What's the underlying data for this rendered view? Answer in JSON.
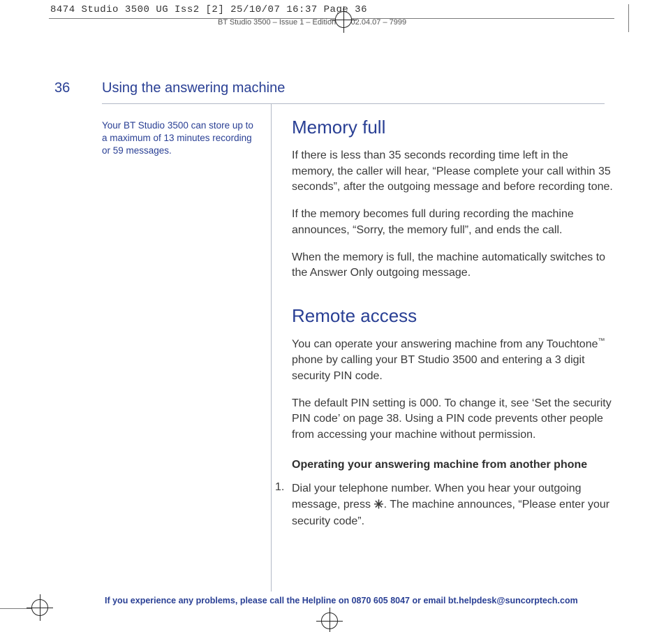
{
  "print": {
    "header": "8474 Studio 3500 UG Iss2 [2]  25/10/07  16:37  Page 36",
    "subheader": "BT Studio 3500 – Issue 1 – Edition 2.1  02.04.07 – 7999"
  },
  "page": {
    "number": "36",
    "section": "Using the answering machine"
  },
  "sidenote": "Your BT Studio 3500 can store up to a maximum of 13 minutes recording or 59 messages.",
  "memory": {
    "heading": "Memory full",
    "p1": "If there is less than 35 seconds recording time left in the memory, the caller will hear, “Please complete your call within 35 seconds”, after the outgoing message and before recording tone.",
    "p2": "If the memory becomes full during recording the machine announces, “Sorry, the memory full”, and ends the call.",
    "p3": "When the memory is full, the machine automatically switches to the Answer Only outgoing message."
  },
  "remote": {
    "heading": "Remote access",
    "p1a": "You can operate your answering machine from any Touchtone",
    "tm": "™",
    "p1b": " phone by calling your BT Studio 3500 and entering a 3 digit security PIN code.",
    "p2": "The default PIN setting is 000. To change it, see ‘Set the security PIN code’ on page 38. Using a PIN code prevents other people from accessing your machine without permission.",
    "sub": "Operating your answering machine from another phone",
    "step1_num": "1.",
    "step1a": "Dial your telephone number. When you hear your outgoing message, press ",
    "star": "✳",
    "step1b": ". The machine announces, “Please enter your security code”."
  },
  "footer": "If you experience any problems, please call the Helpline on 0870 605 8047 or email bt.helpdesk@suncorptech.com"
}
